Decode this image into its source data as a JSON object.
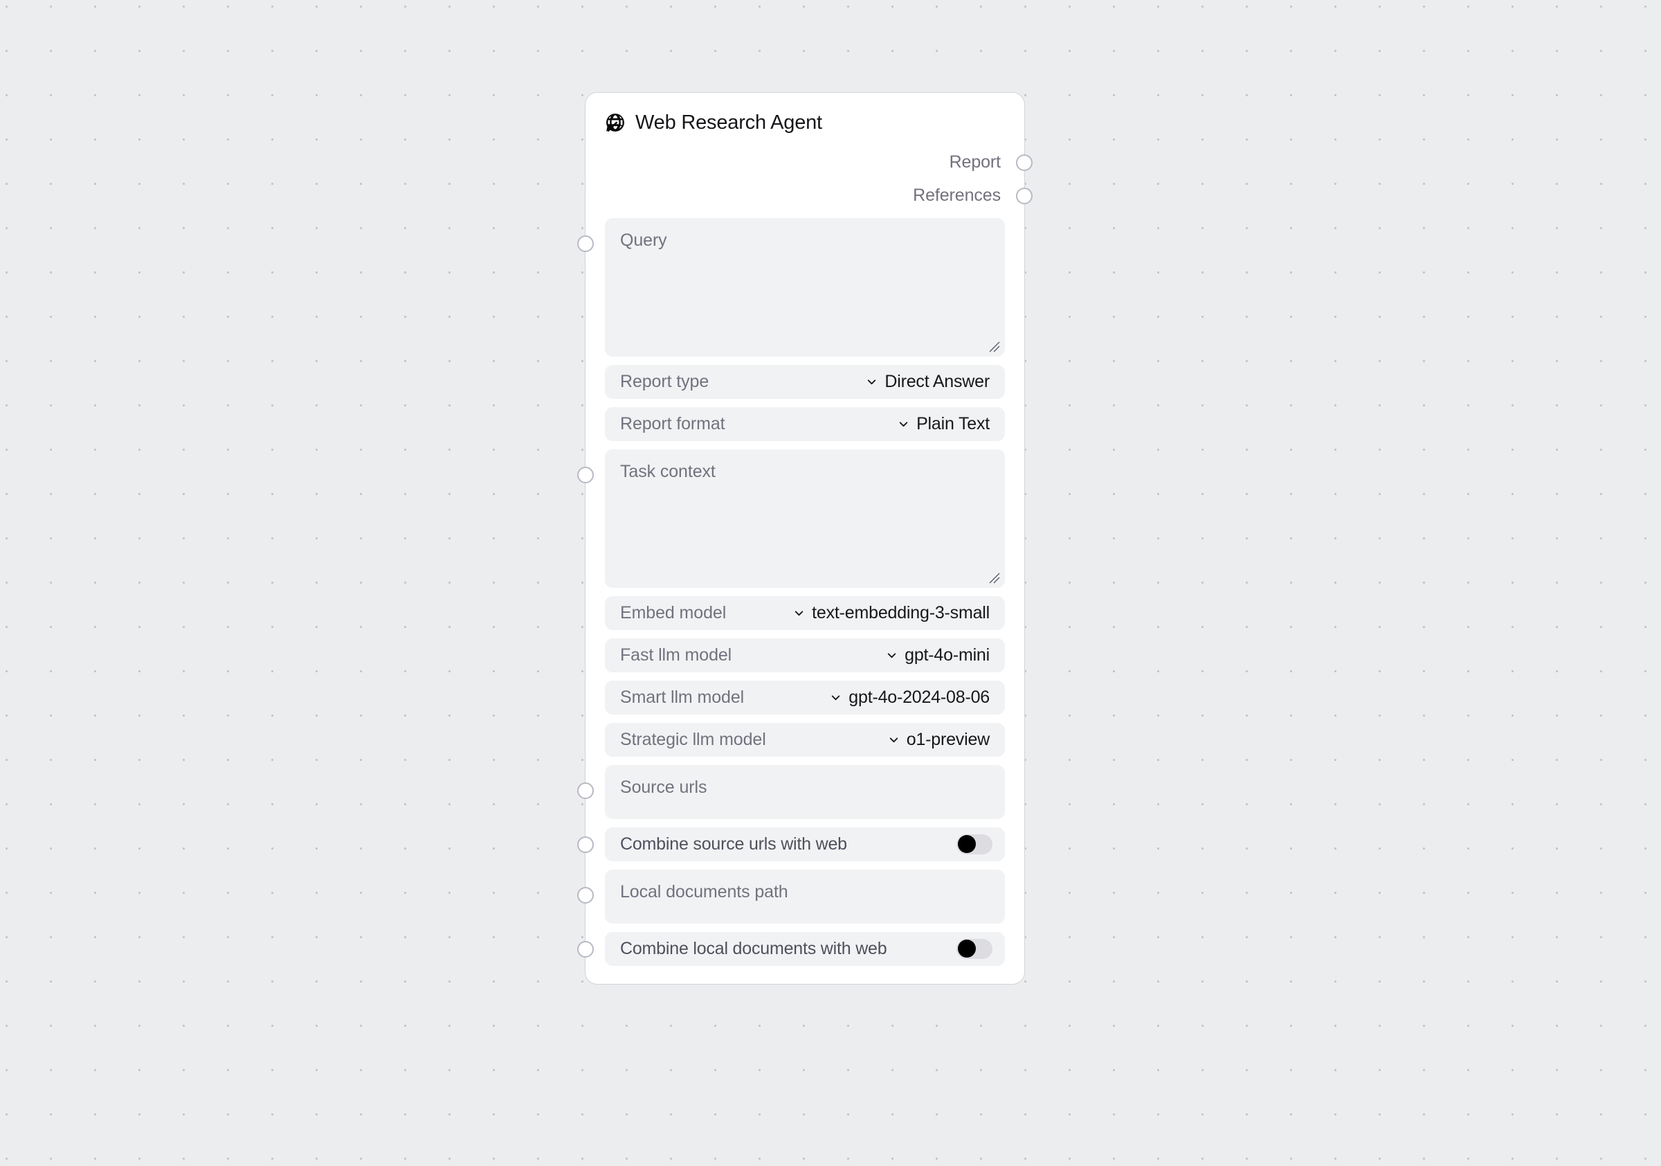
{
  "canvas": {
    "background_color": "#ecedef",
    "dot_color": "#c3c4cb"
  },
  "node": {
    "title": "Web Research Agent",
    "icon": "globe-arrow-icon",
    "outputs": [
      {
        "label": "Report",
        "handle": "output-handle"
      },
      {
        "label": "References",
        "handle": "output-handle"
      }
    ],
    "fields": [
      {
        "kind": "textarea",
        "name": "query",
        "placeholder": "Query",
        "value": "",
        "size": "tall",
        "has_input_handle": true,
        "resizable": true
      },
      {
        "kind": "select",
        "name": "report-type",
        "label": "Report type",
        "value": "Direct Answer",
        "has_input_handle": false
      },
      {
        "kind": "select",
        "name": "report-format",
        "label": "Report format",
        "value": "Plain Text",
        "has_input_handle": false
      },
      {
        "kind": "textarea",
        "name": "task-context",
        "placeholder": "Task context",
        "value": "",
        "size": "tall",
        "has_input_handle": true,
        "resizable": true
      },
      {
        "kind": "select",
        "name": "embed-model",
        "label": "Embed model",
        "value": "text-embedding-3-small",
        "has_input_handle": false
      },
      {
        "kind": "select",
        "name": "fast-llm-model",
        "label": "Fast llm model",
        "value": "gpt-4o-mini",
        "has_input_handle": false
      },
      {
        "kind": "select",
        "name": "smart-llm-model",
        "label": "Smart llm model",
        "value": "gpt-4o-2024-08-06",
        "has_input_handle": false
      },
      {
        "kind": "select",
        "name": "strategic-llm-model",
        "label": "Strategic llm model",
        "value": "o1-preview",
        "has_input_handle": false
      },
      {
        "kind": "textarea",
        "name": "source-urls",
        "placeholder": "Source urls",
        "value": "",
        "size": "short",
        "has_input_handle": true,
        "resizable": false
      },
      {
        "kind": "toggle",
        "name": "combine-source-urls-with-web",
        "label": "Combine source urls with web",
        "checked": false,
        "has_input_handle": true
      },
      {
        "kind": "textarea",
        "name": "local-documents-path",
        "placeholder": "Local documents path",
        "value": "",
        "size": "short",
        "has_input_handle": true,
        "resizable": false
      },
      {
        "kind": "toggle",
        "name": "combine-local-documents-with-web",
        "label": "Combine local documents with web",
        "checked": false,
        "has_input_handle": true
      }
    ]
  }
}
